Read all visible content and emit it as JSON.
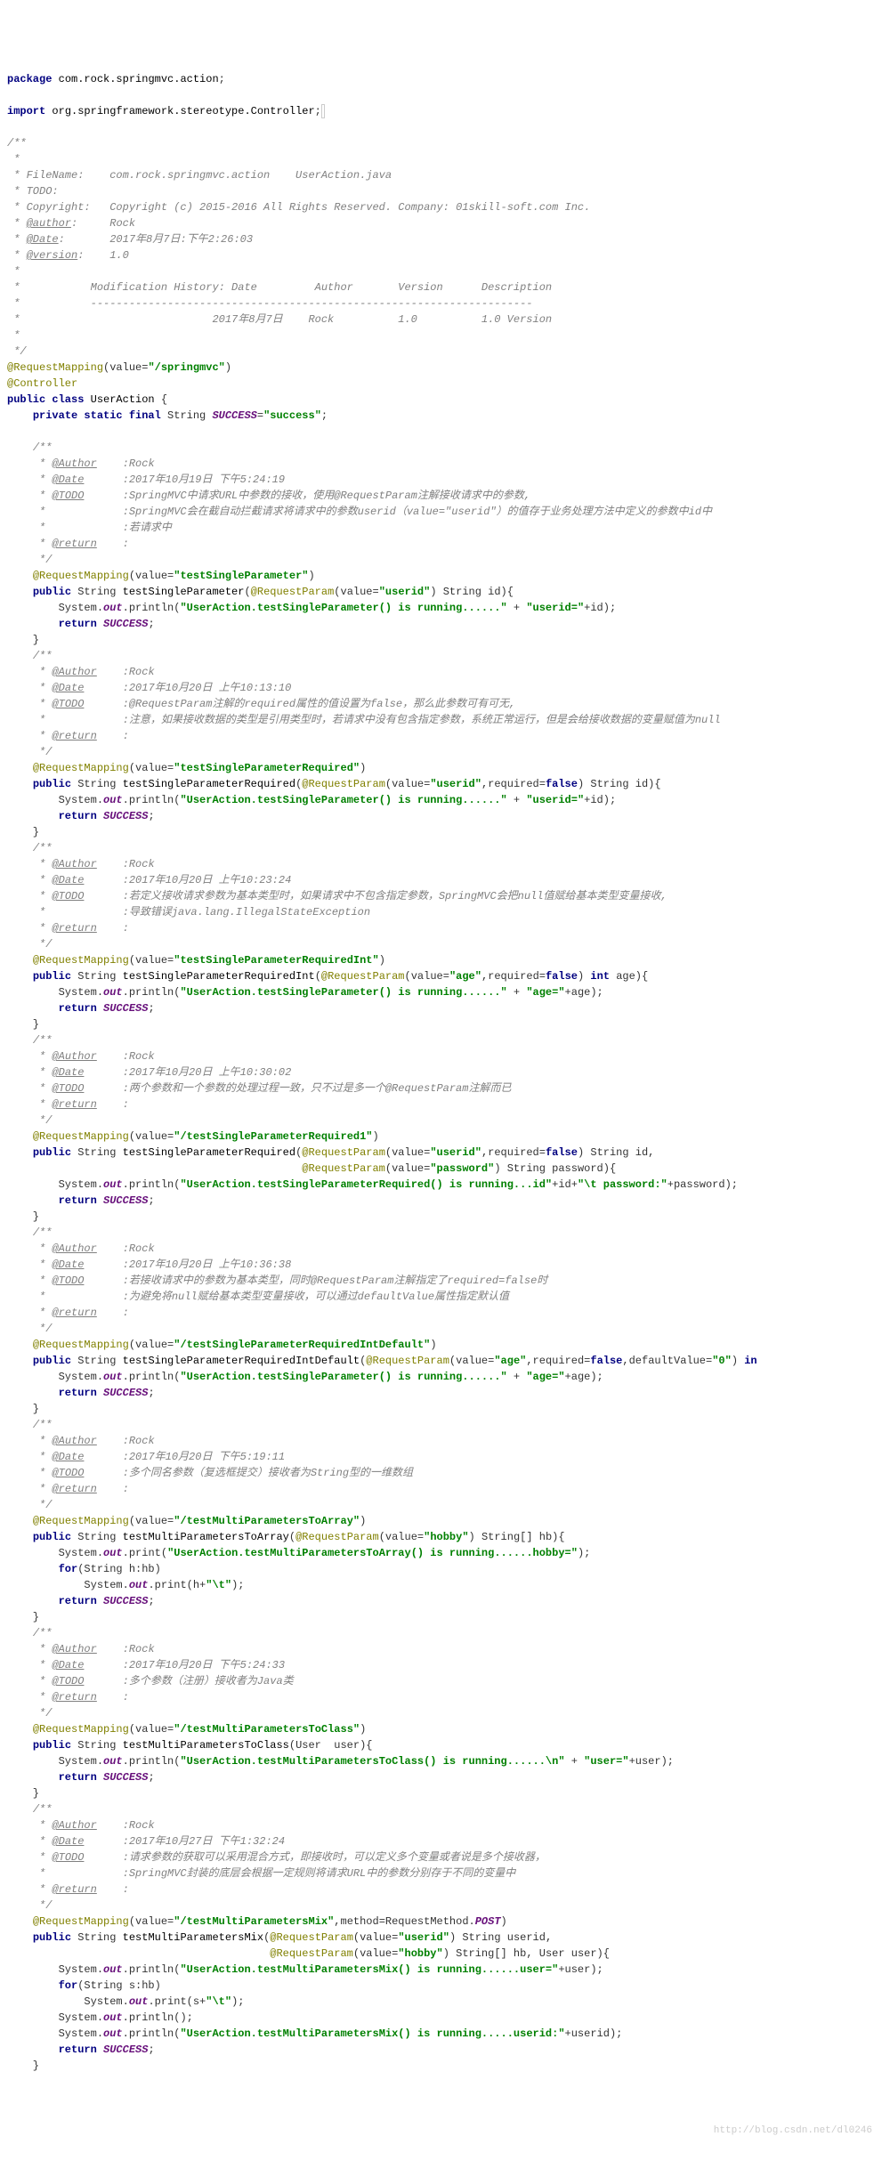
{
  "code": {
    "package": "com.rock.springmvc.action",
    "import": "org.springframework.stereotype.Controller",
    "header": {
      "filename": "com.rock.springmvc.action    UserAction.java",
      "todo": "",
      "copyright": "Copyright (c) 2015-2016 All Rights Reserved. Company: 01skill-soft.com Inc.",
      "author": "Rock",
      "date": "2017年8月7日:下午2:26:03",
      "version": "1.0",
      "mod_header": "Modification History: Date         Author       Version      Description",
      "mod_sep": "---------------------------------------------------------------------",
      "mod_row": "2017年8月7日    Rock          1.0          1.0 Version"
    },
    "classAnnotation1": "@RequestMapping",
    "classAnnotation1_value": "/springmvc",
    "classAnnotation2": "@Controller",
    "className": "UserAction",
    "successField": "SUCCESS",
    "successValue": "success",
    "methods": [
      {
        "doc_author": "Rock",
        "doc_date": "2017年10月19日 下午5:24:19",
        "doc_todo1": "SpringMVC中请求URL中参数的接收，使用@RequestParam注解接收请求中的参数,",
        "doc_todo2": "SpringMVC会在截自动拦截请求将请求中的参数userid（value=\"userid\"）的值存于业务处理方法中定义的参数中id中",
        "doc_todo3": "若请求中",
        "mapping": "testSingleParameter",
        "name": "testSingleParameter",
        "param_annotation": "@RequestParam(value=\"userid\")",
        "param_decl": "String id",
        "println": "UserAction.testSingleParameter() is running......",
        "println_suffix": "userid=",
        "println_var": "id"
      },
      {
        "doc_author": "Rock",
        "doc_date": "2017年10月20日 上午10:13:10",
        "doc_todo1": "@RequestParam注解的required属性的值设置为false，那么此参数可有可无,",
        "doc_todo2": "注意，如果接收数据的类型是引用类型时，若请求中没有包含指定参数，系统正常运行，但是会给接收数据的变量赋值为null",
        "mapping": "testSingleParameterRequired",
        "name": "testSingleParameterRequired",
        "param_annotation": "@RequestParam(value=\"userid\",required=false)",
        "param_decl": "String id",
        "println": "UserAction.testSingleParameter() is running......",
        "println_suffix": "userid=",
        "println_var": "id"
      },
      {
        "doc_author": "Rock",
        "doc_date": "2017年10月20日 上午10:23:24",
        "doc_todo1": "若定义接收请求参数为基本类型时，如果请求中不包含指定参数，SpringMVC会把null值赋给基本类型变量接收,",
        "doc_todo2": "导致错误java.lang.IllegalStateException",
        "mapping": "testSingleParameterRequiredInt",
        "name": "testSingleParameterRequiredInt",
        "param_annotation": "@RequestParam(value=\"age\",required=false)",
        "param_decl": "int age",
        "println": "UserAction.testSingleParameter() is running......",
        "println_suffix": "age=",
        "println_var": "age"
      },
      {
        "doc_author": "Rock",
        "doc_date": "2017年10月20日 上午10:30:02",
        "doc_todo1": "两个参数和一个参数的处理过程一致，只不过是多一个@RequestParam注解而已",
        "mapping": "/testSingleParameterRequired1",
        "name": "testSingleParameterRequired",
        "param_annotation": "@RequestParam(value=\"userid\",required=false)",
        "param_decl": "String id",
        "param_annotation2": "@RequestParam(value=\"password\")",
        "param_decl2": "String password",
        "println": "UserAction.testSingleParameterRequired() is running...id",
        "println_suffix": "\\t password:",
        "println_var": "id",
        "println_var2": "password"
      },
      {
        "doc_author": "Rock",
        "doc_date": "2017年10月20日 上午10:36:38",
        "doc_todo1": "若接收请求中的参数为基本类型，同时@RequestParam注解指定了required=false时",
        "doc_todo2": "为避免将null赋给基本类型变量接收，可以通过defaultValue属性指定默认值",
        "mapping": "/testSingleParameterRequiredIntDefault",
        "name": "testSingleParameterRequiredIntDefault",
        "param_annotation": "@RequestParam(value=\"age\",required=false,defaultValue=\"0\")",
        "param_decl": "in",
        "println": "UserAction.testSingleParameter() is running......",
        "println_suffix": "age=",
        "println_var": "age"
      },
      {
        "doc_author": "Rock",
        "doc_date": "2017年10月20日 下午5:19:11",
        "doc_todo1": "多个同名参数（复选框提交）接收者为String型的一维数组",
        "mapping": "/testMultiParametersToArray",
        "name": "testMultiParametersToArray",
        "param_annotation": "@RequestParam(value=\"hobby\")",
        "param_decl": "String[] hb",
        "print": "UserAction.testMultiParametersToArray() is running......hobby=",
        "for_decl": "String h:hb",
        "for_print_var": "h",
        "for_print_sep": "\\t"
      },
      {
        "doc_author": "Rock",
        "doc_date": "2017年10月20日 下午5:24:33",
        "doc_todo1": "多个参数（注册）接收者为Java类",
        "mapping": "/testMultiParametersToClass",
        "name": "testMultiParametersToClass",
        "param_decl": "User  user",
        "println": "UserAction.testMultiParametersToClass() is running......\\n",
        "println_suffix": "user=",
        "println_var": "user"
      },
      {
        "doc_author": "Rock",
        "doc_date": "2017年10月27日 下午1:32:24",
        "doc_todo1": "请求参数的获取可以采用混合方式，即接收时，可以定义多个变量或者说是多个接收器，",
        "doc_todo2": "SpringMVC封装的底层会根据一定规则将请求URL中的参数分别存于不同的变量中",
        "mapping": "/testMultiParametersMix",
        "method_http": "POST",
        "name": "testMultiParametersMix",
        "param_annotation": "@RequestParam(value=\"userid\")",
        "param_decl": "String userid",
        "param_annotation2": "@RequestParam(value=\"hobby\")",
        "param_decl2": "String[] hb, User user",
        "println1": "UserAction.testMultiParametersMix() is running......user=",
        "println1_var": "user",
        "for_decl": "String s:hb",
        "for_print_var": "s",
        "for_print_sep": "\\t",
        "println2": "UserAction.testMultiParametersMix() is running.....userid:",
        "println2_var": "userid"
      }
    ]
  },
  "watermark": "http://blog.csdn.net/dl0246"
}
